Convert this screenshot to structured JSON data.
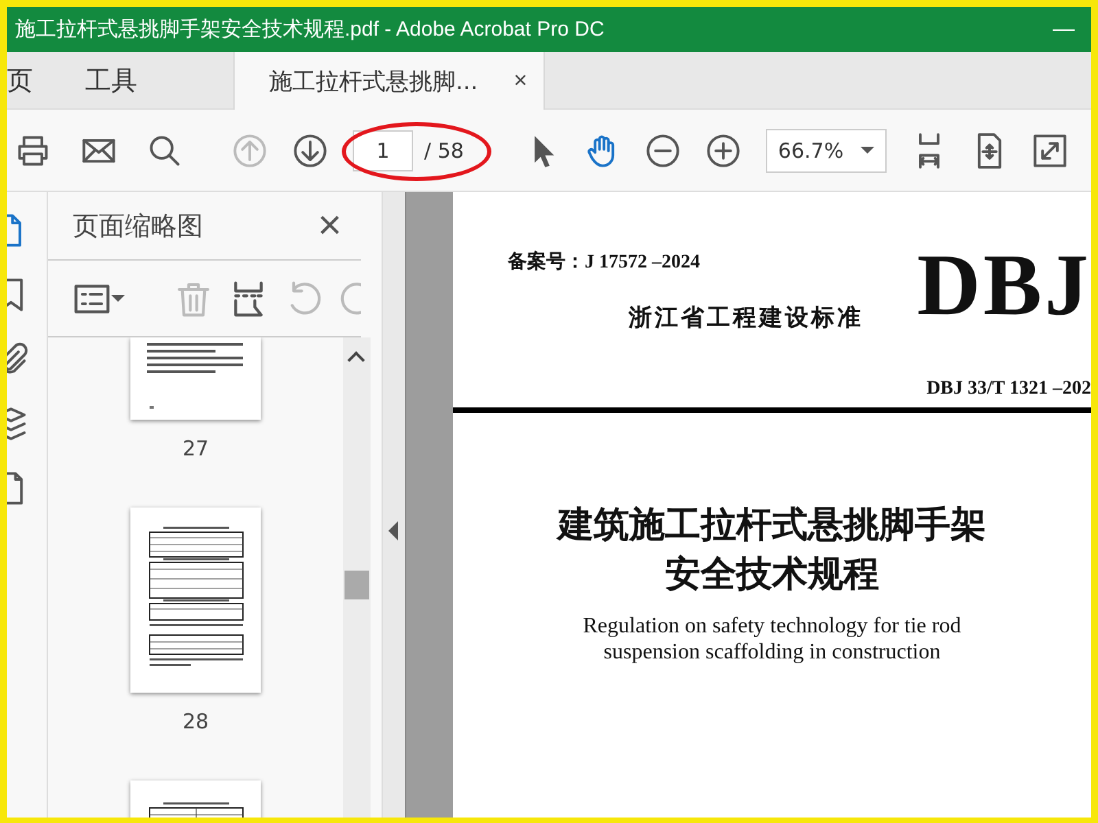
{
  "window": {
    "title": "施工拉杆式悬挑脚手架安全技术规程.pdf - Adobe Acrobat Pro DC",
    "minimize": "—"
  },
  "tabs": [
    {
      "kind": "nav",
      "label": "页",
      "selected": false
    },
    {
      "kind": "nav",
      "label": "工具",
      "selected": false
    },
    {
      "kind": "document",
      "label": "施工拉杆式悬挑脚...",
      "close": "×",
      "selected": true
    }
  ],
  "toolbar": {
    "groups": [
      [
        {
          "kind": "print",
          "selected": false,
          "disabled": false
        },
        {
          "kind": "mail",
          "selected": false,
          "disabled": false
        },
        {
          "kind": "search",
          "selected": false,
          "disabled": false
        }
      ],
      [
        {
          "kind": "up",
          "selected": false,
          "disabled": true
        },
        {
          "kind": "down",
          "selected": false,
          "disabled": false
        },
        {
          "kind": "page_field",
          "value": "1",
          "total": "/ 58"
        }
      ],
      [
        {
          "kind": "select",
          "selected": false,
          "disabled": false
        },
        {
          "kind": "hand",
          "selected": true,
          "disabled": false
        },
        {
          "kind": "zoom_out",
          "selected": false,
          "disabled": false
        },
        {
          "kind": "zoom_in",
          "selected": false,
          "disabled": false
        },
        {
          "kind": "zoom_field",
          "value": "66.7%"
        },
        {
          "kind": "fit_page",
          "selected": false,
          "disabled": false
        },
        {
          "kind": "pan",
          "selected": false,
          "disabled": false
        },
        {
          "kind": "fullscreen",
          "selected": false,
          "disabled": false
        }
      ]
    ]
  },
  "rail": [
    {
      "kind": "pages",
      "selected": true
    },
    {
      "kind": "bookmark",
      "selected": false
    },
    {
      "kind": "clip",
      "selected": false
    },
    {
      "kind": "layers",
      "selected": false
    },
    {
      "kind": "page",
      "selected": false
    }
  ],
  "thumbnail_panel": {
    "title": "页面缩略图",
    "close": "×",
    "tools": [
      {
        "kind": "options",
        "disabled": false
      },
      {
        "kind": "trash",
        "disabled": true
      },
      {
        "kind": "extract",
        "disabled": false
      },
      {
        "kind": "rotate_left",
        "disabled": true
      },
      {
        "kind": "rotate_right",
        "disabled": true
      }
    ],
    "thumbnails": [
      {
        "kind": "text",
        "label": "27"
      },
      {
        "kind": "tables",
        "label": "28"
      },
      {
        "kind": "table"
      }
    ]
  },
  "document": {
    "filing": "备案号：J 17572 –2024",
    "standard": "浙江省工程建设标准",
    "mark": "DBJ",
    "code": "DBJ 33/T 1321 –202",
    "title": [
      "建筑施工拉杆式悬挑脚手架",
      "安全技术规程"
    ],
    "subtitle": [
      "Regulation on safety technology for tie rod",
      "suspension scaffolding in construction"
    ]
  }
}
